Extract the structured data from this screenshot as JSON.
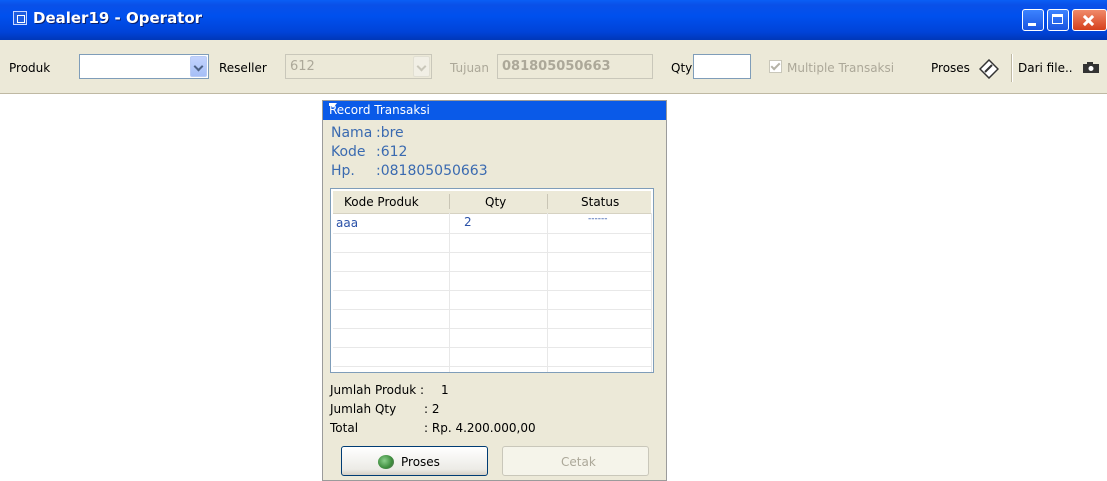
{
  "window": {
    "title": "Dealer19 - Operator"
  },
  "toolbar": {
    "produk_label": "Produk",
    "produk_value": "",
    "reseller_label": "Reseller",
    "reseller_value": "612",
    "tujuan_label": "Tujuan",
    "tujuan_value": "081805050663",
    "qty_label": "Qty",
    "qty_value": "",
    "multiple_label": "Multiple Transaksi",
    "multiple_checked": true,
    "proses_label": "Proses",
    "darifile_label": "Dari file.."
  },
  "panel": {
    "title": "Record Transaksi",
    "nama_label": "Nama",
    "nama_value": ":bre",
    "kode_label": "Kode",
    "kode_value": ":612",
    "hp_label": "Hp.",
    "hp_value": ":081805050663",
    "columns": [
      "Kode Produk",
      "Qty",
      "Status"
    ],
    "rows": [
      {
        "kode": "aaa",
        "qty": "2",
        "status": "------"
      }
    ],
    "jumlah_produk_label": "Jumlah Produk :",
    "jumlah_produk_value": "1",
    "jumlah_qty_label": "Jumlah Qty",
    "jumlah_qty_value": ": 2",
    "total_label": "Total",
    "total_value": ": Rp. 4.200.000,00",
    "proses_button": "Proses",
    "cetak_button": "Cetak"
  },
  "colors": {
    "titlebar": "#0050ee",
    "panel_header": "#0a5ae8",
    "info_text": "#3a6ab0"
  }
}
